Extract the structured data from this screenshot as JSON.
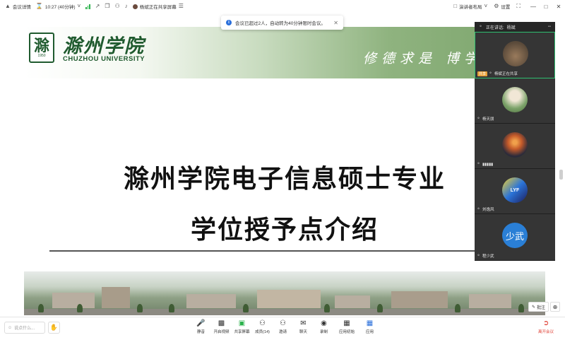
{
  "topbar": {
    "meeting_details": "会议详情",
    "timer": "10:27 (40分钟)",
    "recording_user": "杨斌正在共享屏幕",
    "speaker_layout": "演讲者布局",
    "settings": "设置"
  },
  "notice": {
    "text": "会议已超过2人，自动转为40分钟限时会议。"
  },
  "slide": {
    "university_cn": "滁州学院",
    "university_en": "CHUZHOU UNIVERSITY",
    "seal_year": "1950",
    "seal_glyph": "滁",
    "motto": "修德求是 博学",
    "title_line1": "滁州学院电子信息硕士专业",
    "title_line2": "学位授予点介绍"
  },
  "panel": {
    "speaking_label": "正在讲话:",
    "speaking_name": "杨斌",
    "participants": [
      {
        "name": "杨斌正在共享",
        "badge": "共享",
        "avatar": "photo-outdoor",
        "active": true
      },
      {
        "name": "杨天朋",
        "avatar": "photo-person"
      },
      {
        "name": "▮▮▮▮▮",
        "avatar": "photo-sunset"
      },
      {
        "name": "刘逸风",
        "avatar": "logo-lyf"
      },
      {
        "name": "程少武",
        "avatar": "text",
        "avatar_text": "少武"
      }
    ]
  },
  "floating": {
    "annotate": "批注"
  },
  "bottombar": {
    "chat_placeholder": "说点什么...",
    "tools": [
      {
        "label": "静音",
        "icon": "microphone-icon"
      },
      {
        "label": "开启视频",
        "icon": "camera-off-icon"
      },
      {
        "label": "共享屏幕",
        "icon": "screen-share-icon"
      },
      {
        "label": "成员(14)",
        "icon": "members-icon"
      },
      {
        "label": "邀请",
        "icon": "invite-icon"
      },
      {
        "label": "聊天",
        "icon": "chat-icon"
      },
      {
        "label": "录制",
        "icon": "record-icon"
      },
      {
        "label": "应用初始",
        "icon": "apps-icon"
      },
      {
        "label": "应用",
        "icon": "apps-grid-icon"
      }
    ],
    "leave": "离开会议"
  }
}
